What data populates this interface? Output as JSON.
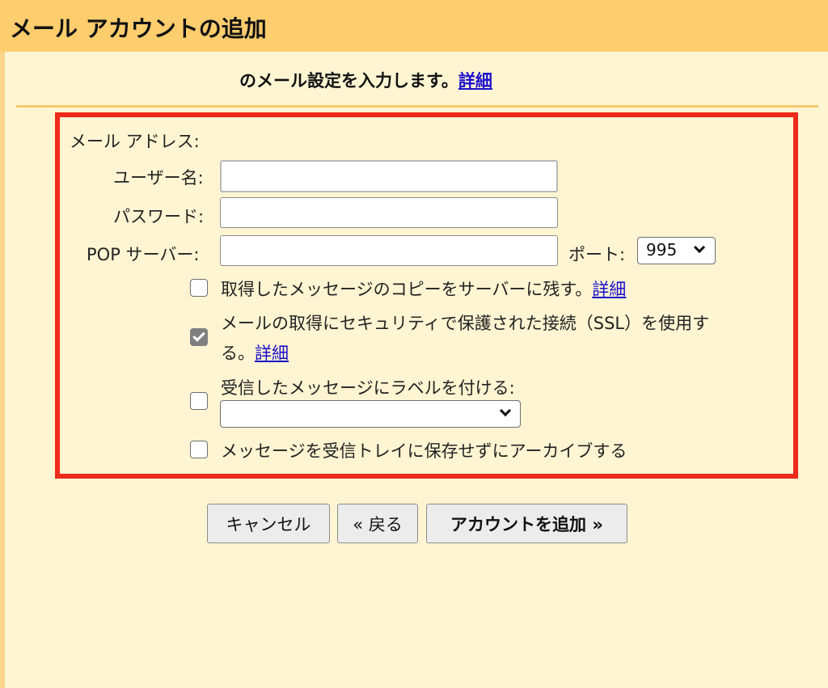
{
  "dialog": {
    "title": "メール アカウントの追加",
    "intro_text": "のメール設定を入力します。",
    "details_link": "詳細"
  },
  "form": {
    "email_label": "メール アドレス:",
    "email_value": "",
    "username_label": "ユーザー名:",
    "username_value": "",
    "password_label": "パスワード:",
    "password_value": "",
    "pop_label": "POP サーバー:",
    "pop_value": "",
    "port_label": "ポート:",
    "port_value": "995"
  },
  "options": {
    "leave_copy": {
      "label": "取得したメッセージのコピーをサーバーに残す。",
      "link": "詳細",
      "checked": false
    },
    "ssl": {
      "label_line1": "メールの取得にセキュリティで保護された接続（SSL）を使用す",
      "label_line2": "る。",
      "link": "詳細",
      "checked": true
    },
    "label_incoming": {
      "label": "受信したメッセージにラベルを付ける:",
      "select_value": "",
      "checked": false
    },
    "archive": {
      "label": "メッセージを受信トレイに保存せずにアーカイブする",
      "checked": false
    }
  },
  "buttons": {
    "cancel": "キャンセル",
    "back": "« 戻る",
    "add_account": "アカウントを追加 »"
  },
  "colors": {
    "header_bg": "#fdcd6e",
    "page_bg": "#fff5d2",
    "highlight_border": "#ee2a1b",
    "link": "#1a0dcc"
  }
}
